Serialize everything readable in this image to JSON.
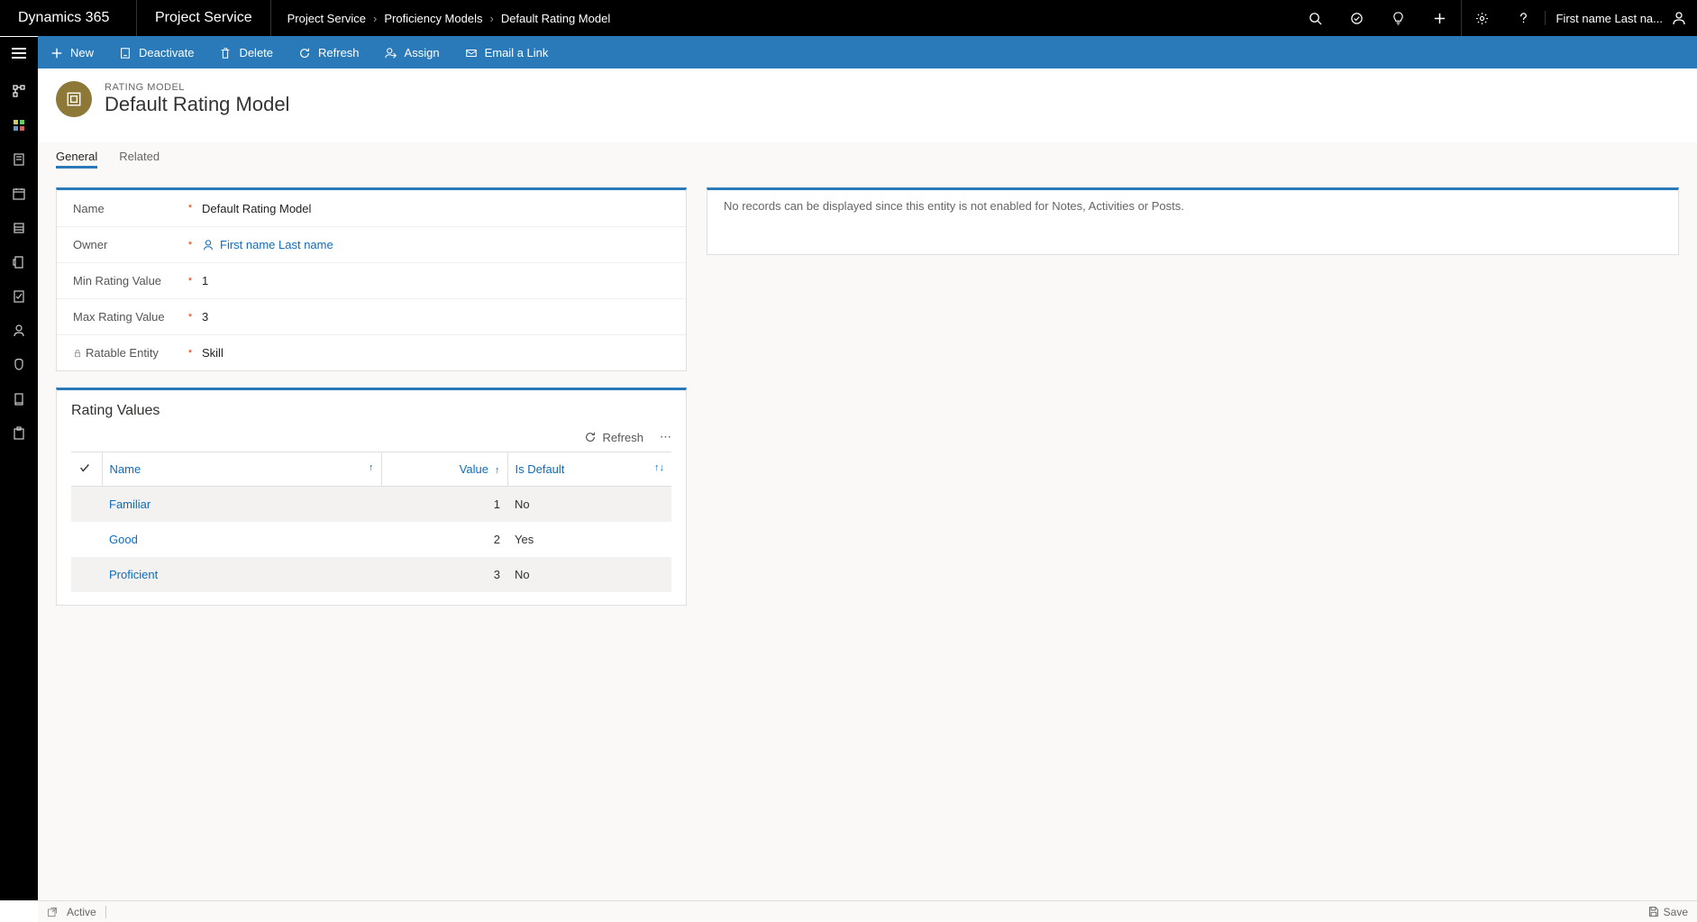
{
  "topbar": {
    "brand": "Dynamics 365",
    "app": "Project Service",
    "breadcrumb": [
      "Project Service",
      "Proficiency Models",
      "Default Rating Model"
    ],
    "user": "First name Last na..."
  },
  "commands": {
    "new": "New",
    "deactivate": "Deactivate",
    "delete": "Delete",
    "refresh": "Refresh",
    "assign": "Assign",
    "email": "Email a Link"
  },
  "record": {
    "entityType": "RATING MODEL",
    "title": "Default Rating Model"
  },
  "tabs": {
    "general": "General",
    "related": "Related"
  },
  "fields": {
    "name": {
      "label": "Name",
      "value": "Default Rating Model"
    },
    "owner": {
      "label": "Owner",
      "value": "First name Last name"
    },
    "min": {
      "label": "Min Rating Value",
      "value": "1"
    },
    "max": {
      "label": "Max Rating Value",
      "value": "3"
    },
    "ratable": {
      "label": "Ratable Entity",
      "value": "Skill"
    }
  },
  "subgrid": {
    "title": "Rating Values",
    "refresh": "Refresh",
    "cols": {
      "name": "Name",
      "value": "Value",
      "isDefault": "Is Default"
    },
    "rows": [
      {
        "name": "Familiar",
        "value": "1",
        "isDefault": "No"
      },
      {
        "name": "Good",
        "value": "2",
        "isDefault": "Yes"
      },
      {
        "name": "Proficient",
        "value": "3",
        "isDefault": "No"
      }
    ]
  },
  "notes": {
    "empty": "No records can be displayed since this entity is not enabled for Notes, Activities or Posts."
  },
  "status": {
    "state": "Active",
    "save": "Save"
  }
}
